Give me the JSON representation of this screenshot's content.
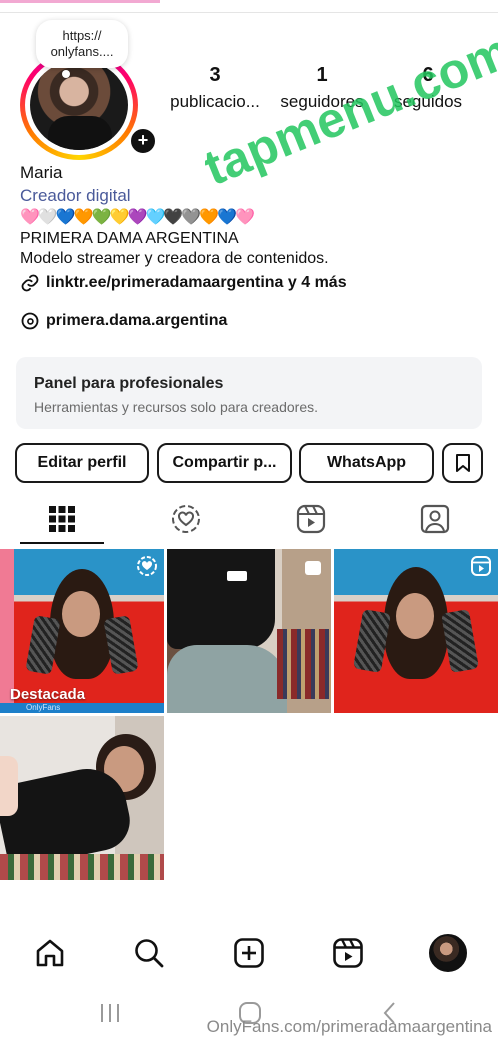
{
  "profile": {
    "note_text": "https://\nonlyfans....",
    "name": "Maria",
    "category": "Creador digital",
    "hearts": "🩷🤍💙🧡💚💛💜🩵🖤🩶🧡💙🩷",
    "bio_line1": "PRIMERA DAMA ARGENTINA",
    "bio_line2": "Modelo streamer y creadora de contenidos.",
    "link": "linktr.ee/primeradamaargentina y 4 más",
    "threads_handle": "primera.dama.argentina"
  },
  "stats": [
    {
      "value": "3",
      "label": "publicacio..."
    },
    {
      "value": "1",
      "label": "seguidores"
    },
    {
      "value": "6",
      "label": "seguidos"
    }
  ],
  "watermark": "tapmenu.com",
  "panel": {
    "title": "Panel para profesionales",
    "subtitle": "Herramientas y recursos solo para creadores."
  },
  "buttons": {
    "edit": "Editar perfil",
    "share": "Compartir p...",
    "whatsapp": "WhatsApp"
  },
  "grid": {
    "pinned_label": "Destacada",
    "of_label": "OnlyFans"
  },
  "footer_watermark": "OnlyFans.com/primeradamaargentina",
  "colors": {
    "accent": "#4a5a9a",
    "watermark": "#22c55e"
  }
}
